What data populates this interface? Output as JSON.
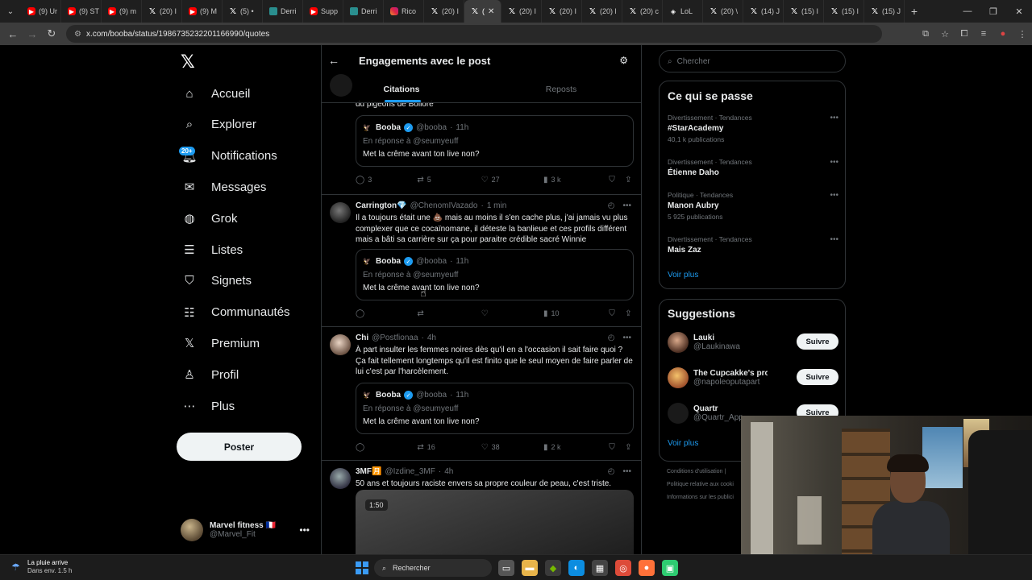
{
  "browser": {
    "tabs": [
      {
        "label": "(9) Ur",
        "icon": "youtube-icon"
      },
      {
        "label": "(9) ST",
        "icon": "youtube-icon"
      },
      {
        "label": "(9) m",
        "icon": "youtube-icon"
      },
      {
        "label": "(20) I",
        "icon": "x-icon"
      },
      {
        "label": "(9) M",
        "icon": "youtube-icon"
      },
      {
        "label": "(5) •",
        "icon": "x-icon"
      },
      {
        "label": "Derri",
        "icon": "doc-icon"
      },
      {
        "label": "Supp",
        "icon": "youtube-icon"
      },
      {
        "label": "Derri",
        "icon": "doc-icon"
      },
      {
        "label": "Rico",
        "icon": "instagram-icon"
      },
      {
        "label": "(20) I",
        "icon": "x-icon"
      },
      {
        "label": "(",
        "icon": "x-icon",
        "active": true
      },
      {
        "label": "(20) I",
        "icon": "x-icon"
      },
      {
        "label": "(20) I",
        "icon": "x-icon"
      },
      {
        "label": "(20) l",
        "icon": "x-icon"
      },
      {
        "label": "(20) c",
        "icon": "x-icon"
      },
      {
        "label": "LoL",
        "icon": "lol-icon"
      },
      {
        "label": "(20) \\",
        "icon": "x-icon"
      },
      {
        "label": "(14) J",
        "icon": "x-icon"
      },
      {
        "label": "(15) I",
        "icon": "x-icon"
      },
      {
        "label": "(15) I",
        "icon": "x-icon"
      },
      {
        "label": "(15) J",
        "icon": "x-icon"
      }
    ],
    "url": "x.com/booba/status/1986735232201166990/quotes"
  },
  "leftnav": {
    "items": [
      {
        "label": "Accueil",
        "icon": "home-icon"
      },
      {
        "label": "Explorer",
        "icon": "search-icon"
      },
      {
        "label": "Notifications",
        "icon": "bell-icon"
      },
      {
        "label": "Messages",
        "icon": "mail-icon"
      },
      {
        "label": "Grok",
        "icon": "grok-icon"
      },
      {
        "label": "Listes",
        "icon": "list-icon"
      },
      {
        "label": "Signets",
        "icon": "bookmark-icon"
      },
      {
        "label": "Communautés",
        "icon": "communities-icon"
      },
      {
        "label": "Premium",
        "icon": "x-premium-icon"
      },
      {
        "label": "Profil",
        "icon": "profile-icon"
      },
      {
        "label": "Plus",
        "icon": "more-icon"
      }
    ],
    "notif_badge": "20+",
    "post_button": "Poster",
    "profile": {
      "name": "Marvel fitness 🇫🇷",
      "handle": "@Marvel_Fit"
    }
  },
  "main": {
    "title": "Engagements avec le post",
    "tabs": [
      "Citations",
      "Reposts"
    ],
    "partial_text": "du pigeons de Bolloré",
    "posts": [
      {
        "quote": {
          "name": "Booba",
          "handle": "@booba",
          "time": "11h",
          "reply": "En réponse à @seumyeuff",
          "text": "Met la crême avant ton live non?"
        },
        "stats": {
          "replies": "3",
          "reposts": "5",
          "likes": "27",
          "views": "3 k"
        }
      },
      {
        "name": "Carrington💎",
        "handle": "@ChenomIVazado",
        "time": "1 min",
        "text": "Il a toujours était une 💩 mais au moins il s'en cache plus, j'ai jamais vu plus complexer que ce cocaïnomane, il déteste la banlieue et ces profils différent mais a bâti sa carrière sur ça pour paraitre crédible sacré Winnie",
        "quote": {
          "name": "Booba",
          "handle": "@booba",
          "time": "11h",
          "reply": "En réponse à @seumyeuff",
          "text": "Met la crême avant ton live non?"
        },
        "stats": {
          "replies": "",
          "reposts": "",
          "likes": "",
          "views": "10"
        }
      },
      {
        "name": "Chi",
        "handle": "@Postfionaa",
        "time": "4h",
        "text": "À part insulter les femmes noires dès qu'il en a l'occasion il sait faire quoi ? Ça fait tellement longtemps qu'il est finito que le seul moyen de faire parler de lui c'est par l'harcèlement.",
        "quote": {
          "name": "Booba",
          "handle": "@booba",
          "time": "11h",
          "reply": "En réponse à @seumyeuff",
          "text": "Met la crême avant ton live non?"
        },
        "stats": {
          "replies": "",
          "reposts": "16",
          "likes": "38",
          "views": "2 k"
        }
      },
      {
        "name": "3MF🈷️",
        "handle": "@Izdine_3MF",
        "time": "4h",
        "text": "50 ans et toujours raciste envers sa propre couleur de peau, c'est triste.",
        "media_duration": "1:50"
      }
    ]
  },
  "right": {
    "search_placeholder": "Chercher",
    "trends_title": "Ce qui se passe",
    "trends": [
      {
        "category": "Divertissement · Tendances",
        "name": "#StarAcademy",
        "count": "40,1 k publications"
      },
      {
        "category": "Divertissement · Tendances",
        "name": "Étienne Daho",
        "count": ""
      },
      {
        "category": "Politique · Tendances",
        "name": "Manon Aubry",
        "count": "5 925 publications"
      },
      {
        "category": "Divertissement · Tendances",
        "name": "Mais Zaz",
        "count": ""
      }
    ],
    "see_more": "Voir plus",
    "suggestions_title": "Suggestions",
    "suggestions": [
      {
        "name": "Lauki",
        "handle": "@Laukinawa",
        "button": "Suivre"
      },
      {
        "name": "The Cupcakke's prop…",
        "handle": "@napoleoputapart",
        "button": "Suivre"
      },
      {
        "name": "Quartr",
        "handle": "@Quartr_App",
        "button": "Suivre"
      }
    ],
    "footer": [
      "Conditions d'utilisation |",
      "Politique relative aux cooki",
      "Informations sur les publici"
    ]
  },
  "taskbar": {
    "weather_title": "La pluie arrive",
    "weather_sub": "Dans env. 1.5 h",
    "search": "Rechercher"
  }
}
